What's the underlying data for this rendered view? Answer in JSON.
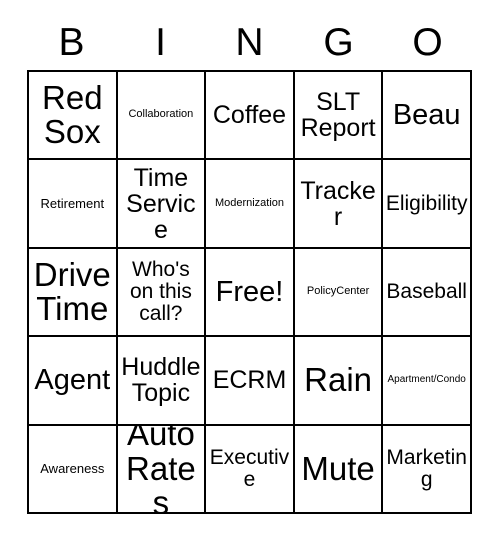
{
  "card": {
    "header_letters": [
      "B",
      "I",
      "N",
      "G",
      "O"
    ],
    "colors": {
      "border": "#000000",
      "cell_background": "#ffffff",
      "text": "#000000",
      "page_background": "#ffffff"
    },
    "rows": [
      [
        {
          "text": "Red Sox",
          "size": "sz-xxl"
        },
        {
          "text": "Collaboration",
          "size": "sz-xxs"
        },
        {
          "text": "Coffee",
          "size": "sz-l"
        },
        {
          "text": "SLT Report",
          "size": "sz-l"
        },
        {
          "text": "Beau",
          "size": "sz-xl"
        }
      ],
      [
        {
          "text": "Retirement",
          "size": "sz-xs"
        },
        {
          "text": "Time Service",
          "size": "sz-l"
        },
        {
          "text": "Modernization",
          "size": "sz-xxs"
        },
        {
          "text": "Tracker",
          "size": "sz-l"
        },
        {
          "text": "Eligibility",
          "size": "sz-m"
        }
      ],
      [
        {
          "text": "Drive Time",
          "size": "sz-xxl"
        },
        {
          "text": "Who's on this call?",
          "size": "sz-m"
        },
        {
          "text": "Free!",
          "size": "sz-xl"
        },
        {
          "text": "PolicyCenter",
          "size": "sz-xxs"
        },
        {
          "text": "Baseball",
          "size": "sz-m"
        }
      ],
      [
        {
          "text": "Agent",
          "size": "sz-xl"
        },
        {
          "text": "Huddle Topic",
          "size": "sz-l"
        },
        {
          "text": "ECRM",
          "size": "sz-l"
        },
        {
          "text": "Rain",
          "size": "sz-xxl"
        },
        {
          "text": "Apartment/Condo",
          "size": "sz-tiny"
        }
      ],
      [
        {
          "text": "Awareness",
          "size": "sz-xs"
        },
        {
          "text": "Auto Rates",
          "size": "sz-xxl"
        },
        {
          "text": "Executive",
          "size": "sz-m"
        },
        {
          "text": "Mute",
          "size": "sz-xxl"
        },
        {
          "text": "Marketing",
          "size": "sz-m"
        }
      ]
    ]
  }
}
